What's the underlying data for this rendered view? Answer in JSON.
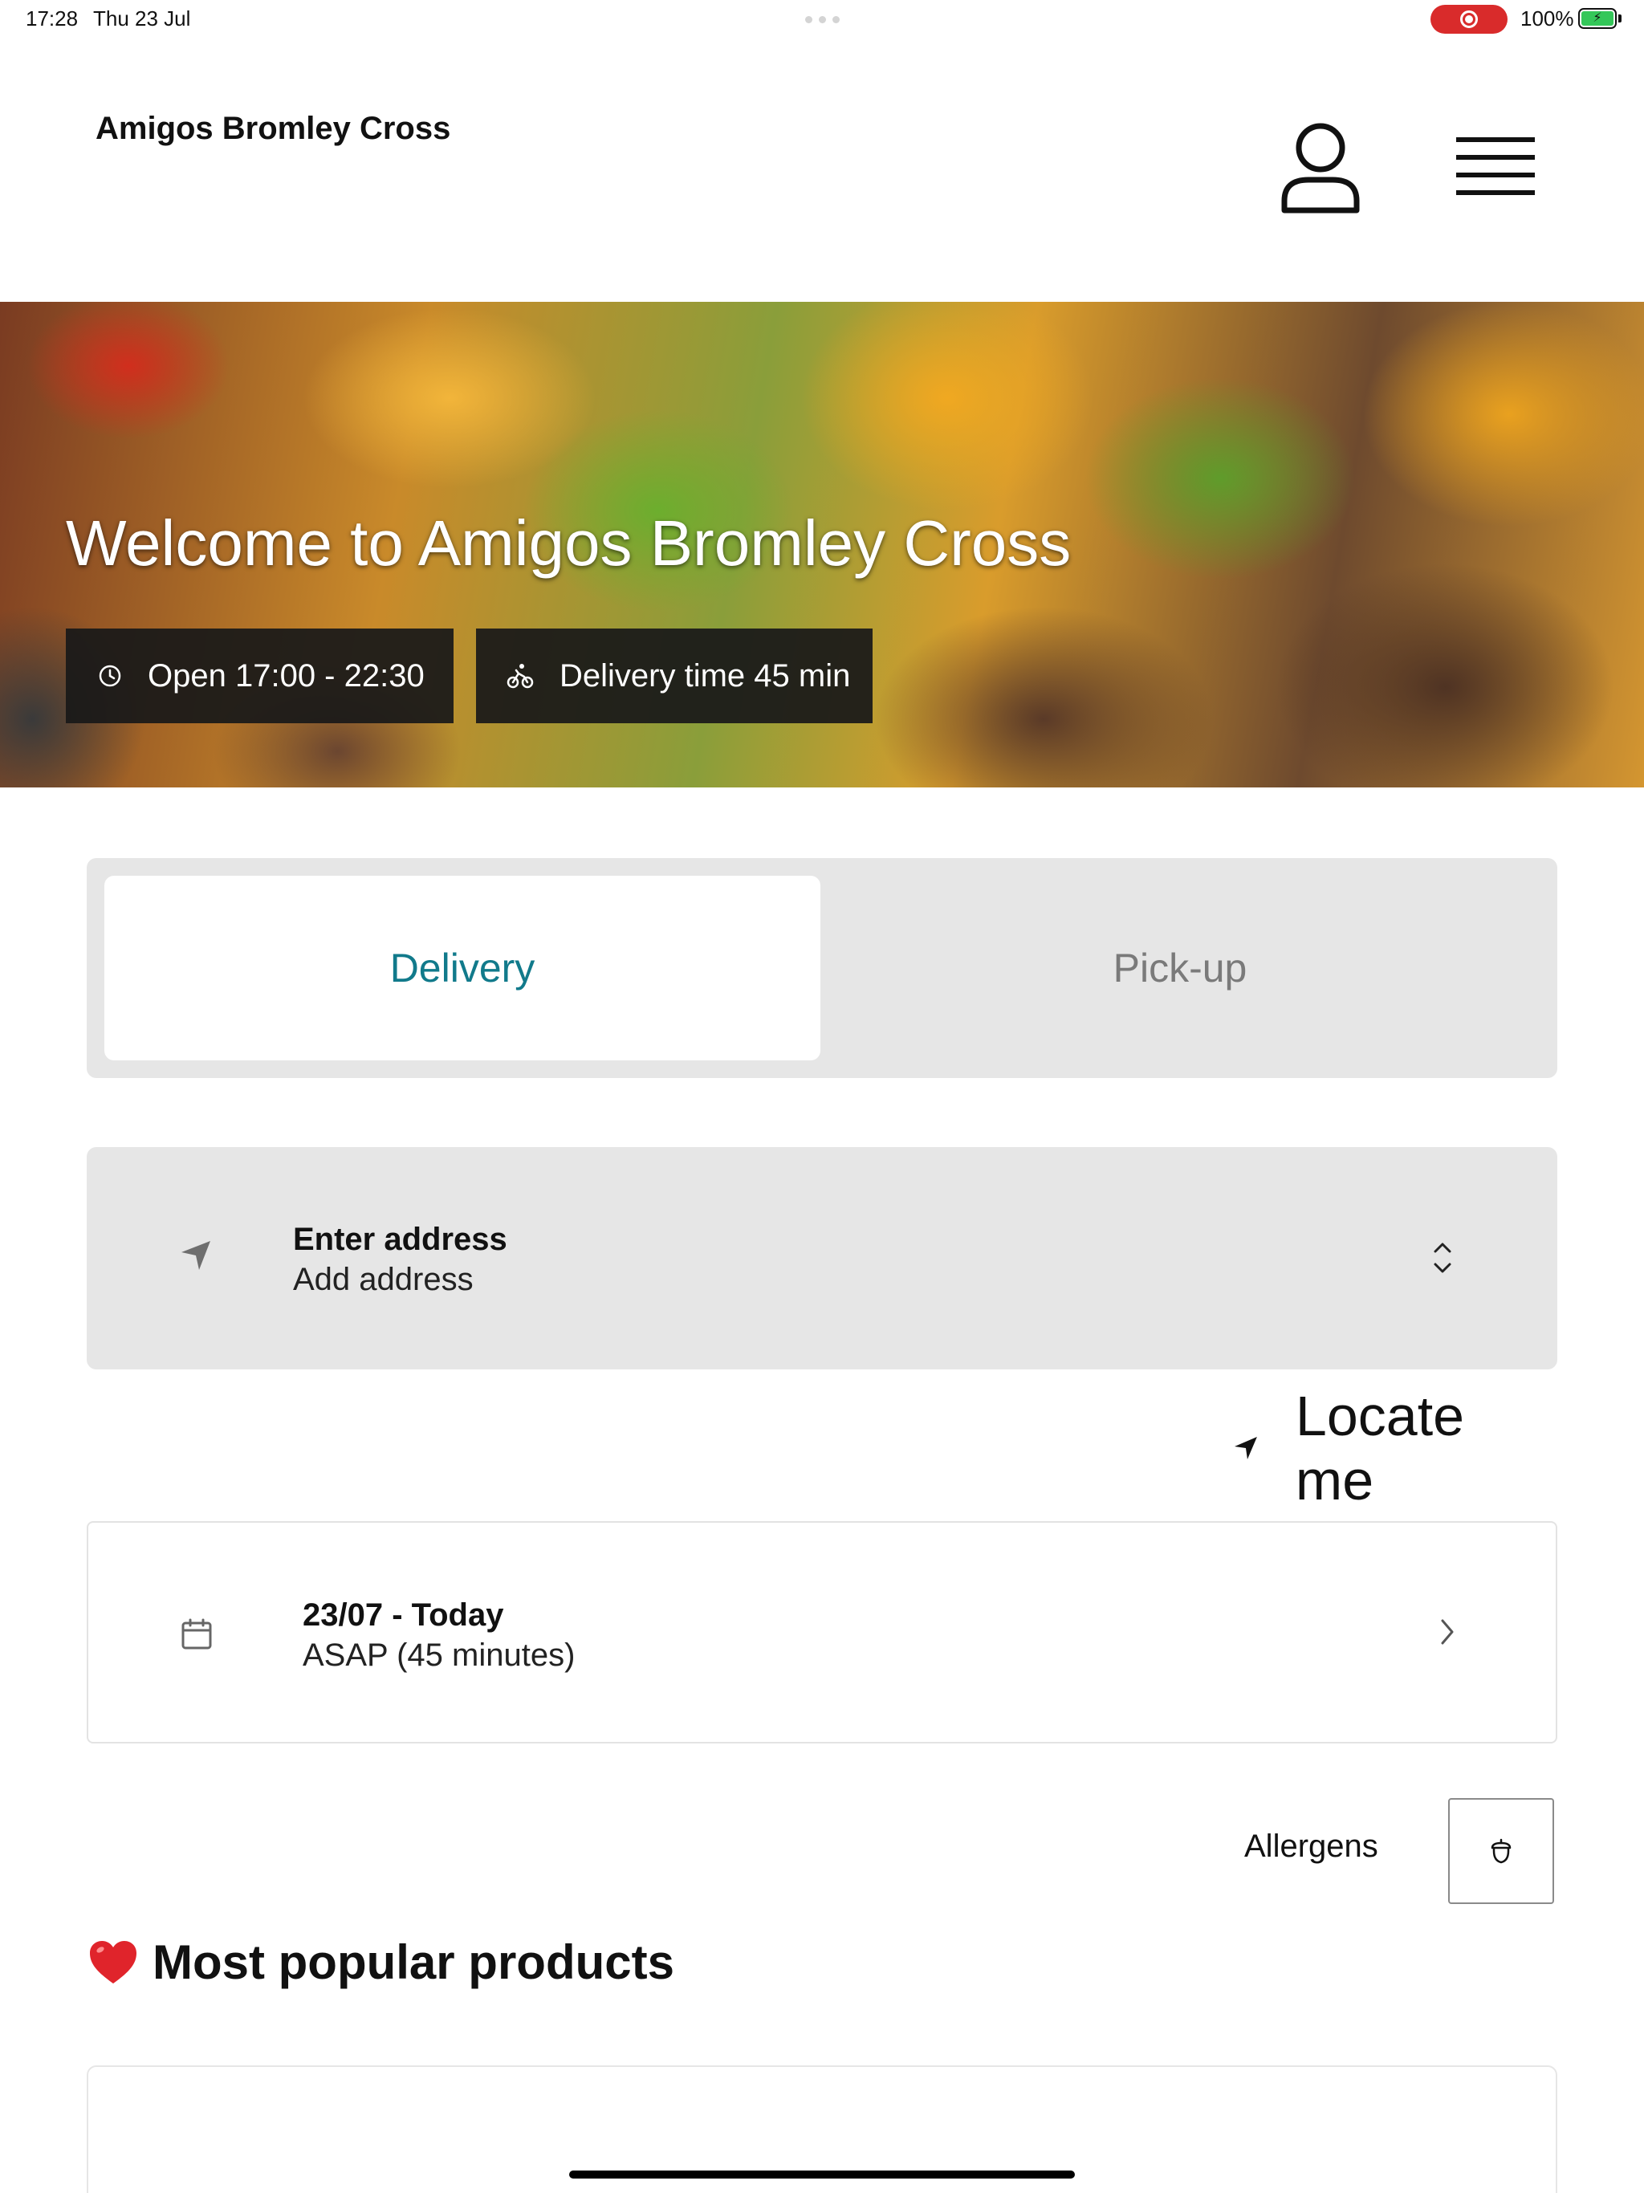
{
  "status_bar": {
    "time": "17:28",
    "date": "Thu 23 Jul",
    "battery_percent": "100%",
    "recording_color": "#d92b2b"
  },
  "header": {
    "restaurant_name": "Amigos Bromley Cross",
    "account_icon": "person-icon",
    "menu_icon": "hamburger-menu-icon"
  },
  "hero": {
    "title": "Welcome to Amigos Bromley Cross",
    "hours_badge": "Open 17:00 - 22:30",
    "hours_icon": "clock-icon",
    "delivery_badge": "Delivery time 45 min",
    "delivery_icon": "bicycle-icon"
  },
  "order_mode": {
    "options": [
      "Delivery",
      "Pick-up"
    ],
    "selected": "Delivery",
    "accent_color": "#117a8b"
  },
  "address": {
    "title": "Enter address",
    "subtitle": "Add address",
    "icon": "location-arrow-icon"
  },
  "locate": {
    "label": "Locate me"
  },
  "schedule": {
    "title": "23/07 - Today",
    "subtitle": "ASAP (45 minutes)",
    "icon": "calendar-icon"
  },
  "allergens": {
    "label": "Allergens",
    "icon": "acorn-icon"
  },
  "popular": {
    "emoji": "❤️",
    "title": "Most popular products"
  }
}
